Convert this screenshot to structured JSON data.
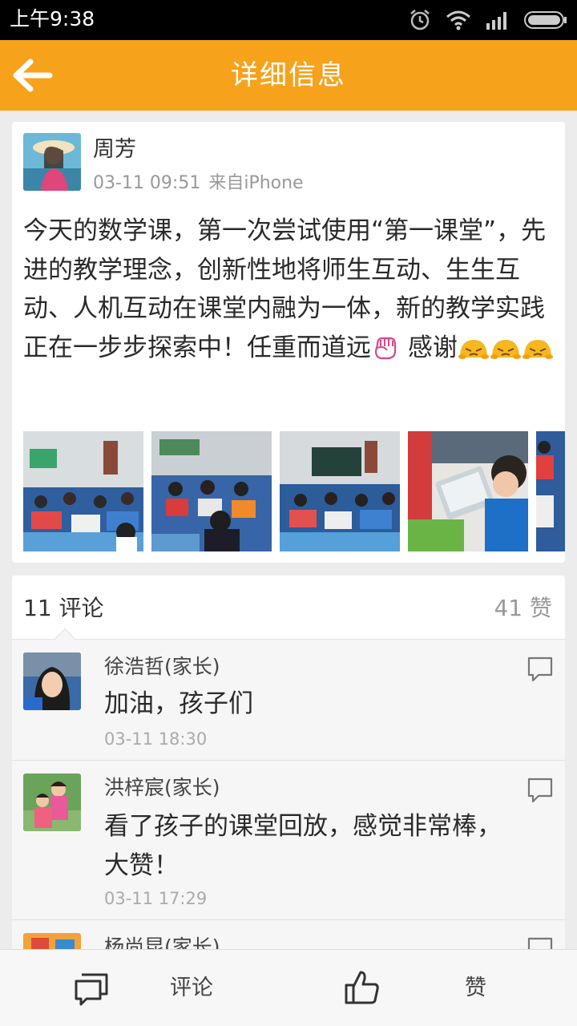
{
  "status_bar": {
    "time": "上午9:38"
  },
  "header": {
    "title": "详细信息"
  },
  "post": {
    "author": "周芳",
    "time": "03-11 09:51",
    "source": "来自iPhone",
    "text_before_fist": "今天的数学课，第一次尝试使用“第一课堂”，先进的教学理念，创新性地将师生互动、生生互动、人机互动在课堂内融为一体，新的教学实践正在一步步探索中！任重而道远",
    "text_after_fist": " 感谢",
    "photo_count_visible": 5
  },
  "comments_section": {
    "count_label": "11 评论",
    "likes_label": "41 赞",
    "items": [
      {
        "name": "徐浩哲(家长)",
        "text": "加油，孩子们",
        "time": "03-11 18:30"
      },
      {
        "name": "洪梓宸(家长)",
        "text": "看了孩子的课堂回放，感觉非常棒，大赞！",
        "time": "03-11 17:29"
      },
      {
        "name": "杨尚昆(家长)",
        "text": "",
        "time": ""
      }
    ]
  },
  "bottom_bar": {
    "comment_label": "评论",
    "like_label": "赞"
  },
  "colors": {
    "accent": "#f7a21b",
    "card": "#ffffff",
    "background": "#ececec"
  }
}
